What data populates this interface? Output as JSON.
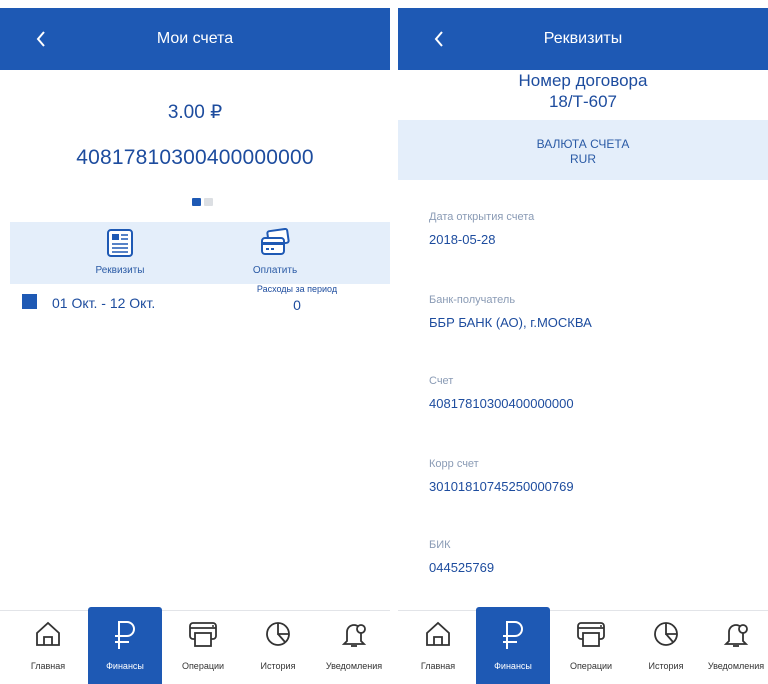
{
  "left": {
    "header": {
      "title": "Мои счета"
    },
    "balance": "3.00 ₽",
    "account_number": "40817810300400000000",
    "carousel": {
      "count": 2,
      "active_index": 0
    },
    "actions": [
      {
        "label": "Реквизиты",
        "icon": "document-icon"
      },
      {
        "label": "Оплатить",
        "icon": "card-icon"
      }
    ],
    "period": {
      "range": "01 Окт. - 12 Окт.",
      "expenses_label": "Расходы за период",
      "expenses_value": "0"
    }
  },
  "right": {
    "header": {
      "title": "Реквизиты"
    },
    "contract": {
      "label": "Номер договора",
      "value": "18/Т-607"
    },
    "currency": {
      "label": "ВАЛЮТА СЧЕТА",
      "value": "RUR"
    },
    "fields": [
      {
        "label": "Дата открытия счета",
        "value": "2018-05-28"
      },
      {
        "label": "Банк-получатель",
        "value": "ББР БАНК (АО), г.МОСКВА"
      },
      {
        "label": "Счет",
        "value": "40817810300400000000"
      },
      {
        "label": "Корр счет",
        "value": "30101810745250000769"
      },
      {
        "label": "БИК",
        "value": "044525769"
      }
    ]
  },
  "tabbar": {
    "tabs": [
      {
        "label": "Главная",
        "icon": "home-icon"
      },
      {
        "label": "Финансы",
        "icon": "ruble-icon",
        "active": true
      },
      {
        "label": "Операции",
        "icon": "printer-icon"
      },
      {
        "label": "История",
        "icon": "pie-chart-icon"
      },
      {
        "label": "Уведомления",
        "icon": "bell-icon"
      }
    ]
  },
  "colors": {
    "primary": "#1e59b4",
    "text": "#1d4c9e",
    "light_bg": "#e4eefa"
  }
}
